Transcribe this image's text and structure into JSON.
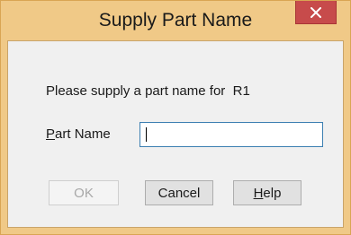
{
  "window": {
    "title": "Supply Part Name",
    "close_icon": "close-icon",
    "titlebar_color": "#f0c987",
    "close_button_color": "#c74b4b"
  },
  "dialog": {
    "prompt": "Please supply a part name for  R1",
    "part_name_label_underlined": "P",
    "part_name_label_rest": "art Name",
    "part_name_value": ""
  },
  "buttons": {
    "ok_label": "OK",
    "ok_enabled": false,
    "cancel_label": "Cancel",
    "help_label_underlined": "H",
    "help_label_rest": "elp"
  }
}
